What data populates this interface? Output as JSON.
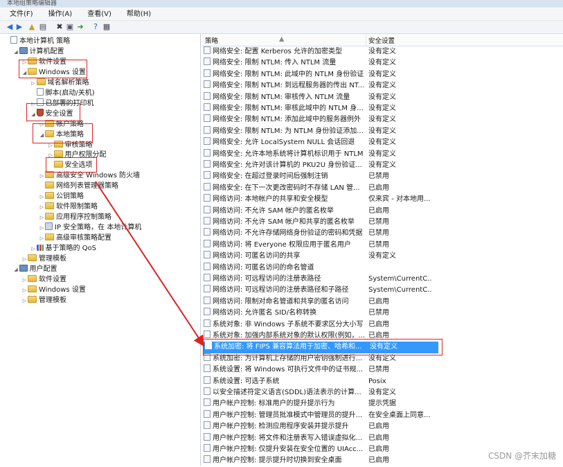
{
  "window": {
    "title": "本地组策略编辑器"
  },
  "menu": [
    "文件(F)",
    "操作(A)",
    "查看(V)",
    "帮助(H)"
  ],
  "toolbar_icons": [
    "back-arrow-icon",
    "forward-arrow-icon",
    "up-folder-icon",
    "show-hide-tree-icon",
    "delete-icon",
    "properties-icon",
    "export-icon",
    "help-icon",
    "view-icon"
  ],
  "tree": [
    {
      "label": "本地计算机 策略",
      "indent": 0,
      "icon": "docico",
      "exp": ""
    },
    {
      "label": "计算机配置",
      "indent": 1,
      "icon": "comp",
      "exp": "◢"
    },
    {
      "label": "软件设置",
      "indent": 2,
      "icon": "folder",
      "exp": "▷"
    },
    {
      "label": "Windows 设置",
      "indent": 2,
      "icon": "folder",
      "exp": "◢"
    },
    {
      "label": "域名解析策略",
      "indent": 3,
      "icon": "folder",
      "exp": "▷"
    },
    {
      "label": "脚本(启动/关机)",
      "indent": 3,
      "icon": "docico",
      "exp": ""
    },
    {
      "label": "已部署的打印机",
      "indent": 3,
      "icon": "docico",
      "exp": "▷"
    },
    {
      "label": "安全设置",
      "indent": 3,
      "icon": "shield",
      "exp": "◢"
    },
    {
      "label": "帐户策略",
      "indent": 4,
      "icon": "folder",
      "exp": "▷"
    },
    {
      "label": "本地策略",
      "indent": 4,
      "icon": "folder",
      "exp": "◢"
    },
    {
      "label": "审核策略",
      "indent": 5,
      "icon": "folder",
      "exp": "▷"
    },
    {
      "label": "用户权限分配",
      "indent": 5,
      "icon": "folder",
      "exp": "▷"
    },
    {
      "label": "安全选项",
      "indent": 5,
      "icon": "folder",
      "exp": ""
    },
    {
      "label": "高级安全 Windows 防火墙",
      "indent": 4,
      "icon": "folder",
      "exp": "▷"
    },
    {
      "label": "网络列表管理器策略",
      "indent": 4,
      "icon": "folder",
      "exp": ""
    },
    {
      "label": "公钥策略",
      "indent": 4,
      "icon": "folder",
      "exp": "▷"
    },
    {
      "label": "软件限制策略",
      "indent": 4,
      "icon": "folder",
      "exp": "▷"
    },
    {
      "label": "应用程序控制策略",
      "indent": 4,
      "icon": "folder",
      "exp": "▷"
    },
    {
      "label": "IP 安全策略，在 本地计算机",
      "indent": 4,
      "icon": "pc",
      "exp": "▷"
    },
    {
      "label": "高级审核策略配置",
      "indent": 4,
      "icon": "folder",
      "exp": "▷"
    },
    {
      "label": "基于策略的 QoS",
      "indent": 3,
      "icon": "chart",
      "exp": "▷"
    },
    {
      "label": "管理模板",
      "indent": 2,
      "icon": "folder",
      "exp": "▷"
    },
    {
      "label": "用户配置",
      "indent": 1,
      "icon": "comp",
      "exp": "◢"
    },
    {
      "label": "软件设置",
      "indent": 2,
      "icon": "folder",
      "exp": "▷"
    },
    {
      "label": "Windows 设置",
      "indent": 2,
      "icon": "folder",
      "exp": "▷"
    },
    {
      "label": "管理模板",
      "indent": 2,
      "icon": "folder",
      "exp": "▷"
    }
  ],
  "list": {
    "columns": {
      "policy": "策略",
      "setting": "安全设置"
    },
    "rows": [
      {
        "p": "网络安全: 配置 Kerberos 允许的加密类型",
        "s": "没有定义"
      },
      {
        "p": "网络安全: 限制 NTLM: 传入 NTLM 流量",
        "s": "没有定义"
      },
      {
        "p": "网络安全: 限制 NTLM: 此域中的 NTLM 身份验证",
        "s": "没有定义"
      },
      {
        "p": "网络安全: 限制 NTLM: 到远程服务器的传出 NT...",
        "s": "没有定义"
      },
      {
        "p": "网络安全: 限制 NTLM: 审核传入 NTLM 流量",
        "s": "没有定义"
      },
      {
        "p": "网络安全: 限制 NTLM: 审核此域中的 NTLM 身...",
        "s": "没有定义"
      },
      {
        "p": "网络安全: 限制 NTLM: 添加此域中的服务器例外",
        "s": "没有定义"
      },
      {
        "p": "网络安全: 限制 NTLM: 为 NTLM 身份验证添加...",
        "s": "没有定义"
      },
      {
        "p": "网络安全: 允许 LocalSystem NULL 会话回退",
        "s": "没有定义"
      },
      {
        "p": "网络安全: 允许本地系统将计算机标识用于 NTLM",
        "s": "没有定义"
      },
      {
        "p": "网络安全: 允许对该计算机的 PKU2U 身份验证...",
        "s": "没有定义"
      },
      {
        "p": "网络安全: 在超过登录时间后强制注销",
        "s": "已禁用"
      },
      {
        "p": "网络安全: 在下一次更改密码时不存储 LAN 管...",
        "s": "已启用"
      },
      {
        "p": "网络访问: 本地帐户的共享和安全模型",
        "s": "仅来宾 - 对本地用..."
      },
      {
        "p": "网络访问: 不允许 SAM 帐户的匿名枚举",
        "s": "已启用"
      },
      {
        "p": "网络访问: 不允许 SAM 帐户和共享的匿名枚举",
        "s": "已禁用"
      },
      {
        "p": "网络访问: 不允许存储网络身份验证的密码和凭据",
        "s": "已禁用"
      },
      {
        "p": "网络访问: 将 Everyone 权限应用于匿名用户",
        "s": "已禁用"
      },
      {
        "p": "网络访问: 可匿名访问的共享",
        "s": "没有定义"
      },
      {
        "p": "网络访问: 可匿名访问的命名管道",
        "s": ""
      },
      {
        "p": "网络访问: 可远程访问的注册表路径",
        "s": "System\\CurrentC..."
      },
      {
        "p": "网络访问: 可远程访问的注册表路径和子路径",
        "s": "System\\CurrentC..."
      },
      {
        "p": "网络访问: 限制对命名管道和共享的匿名访问",
        "s": "已启用"
      },
      {
        "p": "网络访问: 允许匿名 SID/名称转换",
        "s": "已禁用"
      },
      {
        "p": "系统对象: 非 Windows 子系统不要求区分大小写",
        "s": "已启用"
      },
      {
        "p": "系统对象: 加强内部系统对象的默认权限(例如，...",
        "s": "已启用"
      },
      {
        "p": "系统加密: 将 FIPS 兼容算法用于加密、哈希和...",
        "s": "没有定义",
        "selected": true
      },
      {
        "p": "系统加密: 为计算机上存储的用户密钥强制进行...",
        "s": "没有定义"
      },
      {
        "p": "系统设置: 将 Windows 可执行文件中的证书规...",
        "s": "已禁用"
      },
      {
        "p": "系统设置: 可选子系统",
        "s": "Posix"
      },
      {
        "p": "以安全描述符定义语言(SDDL)语法表示的计算...",
        "s": "没有定义"
      },
      {
        "p": "用户帐户控制: 标准用户的提升提示行为",
        "s": "提示凭据"
      },
      {
        "p": "用户帐户控制: 管理员批准模式中管理员的提升...",
        "s": "在安全桌面上同意..."
      },
      {
        "p": "用户帐户控制: 检测应用程序安装并提示提升",
        "s": "已启用"
      },
      {
        "p": "用户帐户控制: 将文件和注册表写入错误虚拟化...",
        "s": "已启用"
      },
      {
        "p": "用户帐户控制: 仅提升安装在安全位置的 UIAcc...",
        "s": "已启用"
      },
      {
        "p": "用户帐户控制: 提示提升时切换到安全桌面",
        "s": "已启用"
      }
    ]
  },
  "watermark": "CSDN @芥末加糖",
  "colors": {
    "highlight": "#3399ff",
    "annotation": "#e02020"
  }
}
